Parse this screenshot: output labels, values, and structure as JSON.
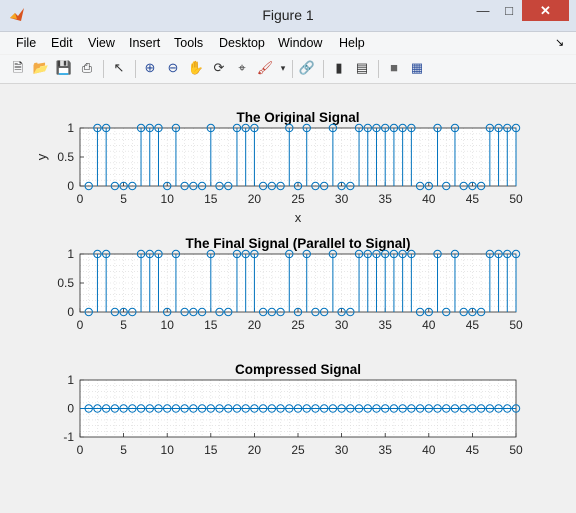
{
  "window": {
    "title": "Figure 1",
    "app_icon": "matlab-icon",
    "controls": [
      "minimize-icon",
      "maximize-icon",
      "close-icon"
    ]
  },
  "menu": [
    "File",
    "Edit",
    "View",
    "Insert",
    "Tools",
    "Desktop",
    "Window",
    "Help"
  ],
  "toolbar": [
    "new-figure-icon",
    "open-icon",
    "save-icon",
    "print-icon",
    "pointer-icon",
    "zoom-in-icon",
    "zoom-out-icon",
    "pan-icon",
    "rotate-icon",
    "data-cursor-icon",
    "brush-icon",
    "link-icon",
    "colorbar-icon",
    "legend-icon",
    "hide-plot-tools-icon",
    "show-plot-tools-icon"
  ],
  "colors": {
    "stem": "#0072bd",
    "close": "#c7463a",
    "axes_bg": "#ffffff"
  },
  "chart_data": [
    {
      "type": "stem",
      "title": "The Original Signal",
      "xlabel": "x",
      "ylabel": "y",
      "xlim": [
        0,
        50
      ],
      "ylim": [
        0,
        1
      ],
      "xticks": [
        "0",
        "5",
        "10",
        "15",
        "20",
        "25",
        "30",
        "35",
        "40",
        "45",
        "50"
      ],
      "yticks": [
        "0",
        "0.5",
        "1"
      ],
      "grid": "minor dotted",
      "x": [
        1,
        2,
        3,
        4,
        5,
        6,
        7,
        8,
        9,
        10,
        11,
        12,
        13,
        14,
        15,
        16,
        17,
        18,
        19,
        20,
        21,
        22,
        23,
        24,
        25,
        26,
        27,
        28,
        29,
        30,
        31,
        32,
        33,
        34,
        35,
        36,
        37,
        38,
        39,
        40,
        41,
        42,
        43,
        44,
        45,
        46,
        47,
        48,
        49,
        50
      ],
      "y": [
        0,
        1,
        1,
        0,
        0,
        0,
        1,
        1,
        1,
        0,
        1,
        0,
        0,
        0,
        1,
        0,
        0,
        1,
        1,
        1,
        0,
        0,
        0,
        1,
        0,
        1,
        0,
        0,
        1,
        0,
        0,
        1,
        1,
        1,
        1,
        1,
        1,
        1,
        0,
        0,
        1,
        0,
        1,
        0,
        0,
        0,
        1,
        1,
        1,
        1
      ]
    },
    {
      "type": "stem",
      "title": "The Final Signal (Parallel to Signal)",
      "xlabel": "",
      "ylabel": "",
      "xlim": [
        0,
        50
      ],
      "ylim": [
        0,
        1
      ],
      "xticks": [
        "0",
        "5",
        "10",
        "15",
        "20",
        "25",
        "30",
        "35",
        "40",
        "45",
        "50"
      ],
      "yticks": [
        "0",
        "0.5",
        "1"
      ],
      "grid": "minor dotted",
      "x": [
        1,
        2,
        3,
        4,
        5,
        6,
        7,
        8,
        9,
        10,
        11,
        12,
        13,
        14,
        15,
        16,
        17,
        18,
        19,
        20,
        21,
        22,
        23,
        24,
        25,
        26,
        27,
        28,
        29,
        30,
        31,
        32,
        33,
        34,
        35,
        36,
        37,
        38,
        39,
        40,
        41,
        42,
        43,
        44,
        45,
        46,
        47,
        48,
        49,
        50
      ],
      "y": [
        0,
        1,
        1,
        0,
        0,
        0,
        1,
        1,
        1,
        0,
        1,
        0,
        0,
        0,
        1,
        0,
        0,
        1,
        1,
        1,
        0,
        0,
        0,
        1,
        0,
        1,
        0,
        0,
        1,
        0,
        0,
        1,
        1,
        1,
        1,
        1,
        1,
        1,
        0,
        0,
        1,
        0,
        1,
        0,
        0,
        0,
        1,
        1,
        1,
        1
      ]
    },
    {
      "type": "stem",
      "title": "Compressed Signal",
      "xlabel": "",
      "ylabel": "",
      "xlim": [
        0,
        50
      ],
      "ylim": [
        -1,
        1
      ],
      "xticks": [
        "0",
        "5",
        "10",
        "15",
        "20",
        "25",
        "30",
        "35",
        "40",
        "45",
        "50"
      ],
      "yticks": [
        "-1",
        "0",
        "1"
      ],
      "grid": "minor dotted",
      "x": [
        1,
        2,
        3,
        4,
        5,
        6,
        7,
        8,
        9,
        10,
        11,
        12,
        13,
        14,
        15,
        16,
        17,
        18,
        19,
        20,
        21,
        22,
        23,
        24,
        25,
        26,
        27,
        28,
        29,
        30,
        31,
        32,
        33,
        34,
        35,
        36,
        37,
        38,
        39,
        40,
        41,
        42,
        43,
        44,
        45,
        46,
        47,
        48,
        49,
        50
      ],
      "y": [
        0,
        0,
        0,
        0,
        0,
        0,
        0,
        0,
        0,
        0,
        0,
        0,
        0,
        0,
        0,
        0,
        0,
        0,
        0,
        0,
        0,
        0,
        0,
        0,
        0,
        0,
        0,
        0,
        0,
        0,
        0,
        0,
        0,
        0,
        0,
        0,
        0,
        0,
        0,
        0,
        0,
        0,
        0,
        0,
        0,
        0,
        0,
        0,
        0,
        0
      ]
    }
  ]
}
